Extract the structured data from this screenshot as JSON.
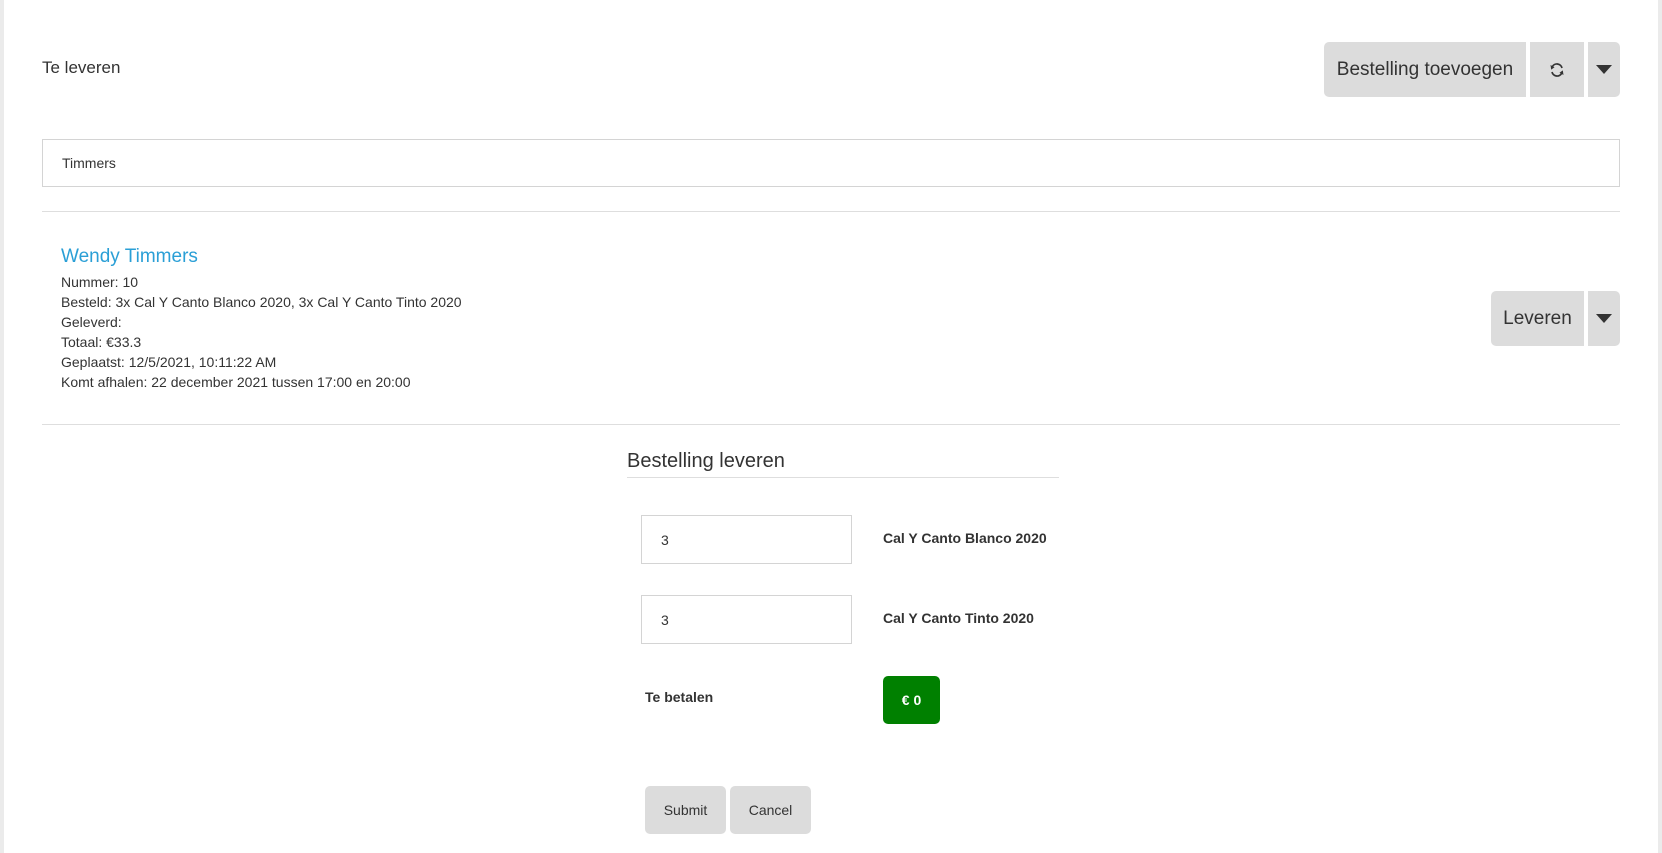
{
  "header": {
    "title": "Te leveren",
    "add_order_label": "Bestelling toevoegen",
    "refresh_icon": "refresh-icon",
    "menu_icon": "caret-down-icon"
  },
  "search": {
    "value": "Timmers"
  },
  "order": {
    "name": "Wendy Timmers",
    "number": "Nummer: 10",
    "ordered": "Besteld: 3x Cal Y Canto Blanco 2020, 3x Cal Y Canto Tinto 2020",
    "delivered": "Geleverd:",
    "total": "Totaal: €33.3",
    "placed": "Geplaatst: 12/5/2021, 10:11:22 AM",
    "pickup": "Komt afhalen: 22 december 2021 tussen 17:00 en 20:00",
    "deliver_label": "Leveren"
  },
  "delivery_form": {
    "title": "Bestelling leveren",
    "items": [
      {
        "quantity": "3",
        "wine": "Cal Y Canto Blanco 2020"
      },
      {
        "quantity": "3",
        "wine": "Cal Y Canto Tinto 2020"
      }
    ],
    "to_pay_label": "Te betalen",
    "to_pay_value": "€ 0",
    "submit_label": "Submit",
    "cancel_label": "Cancel"
  },
  "colors": {
    "link": "#2a9fd6",
    "pay_badge": "#008000",
    "button_bg": "#dcdcdc"
  }
}
